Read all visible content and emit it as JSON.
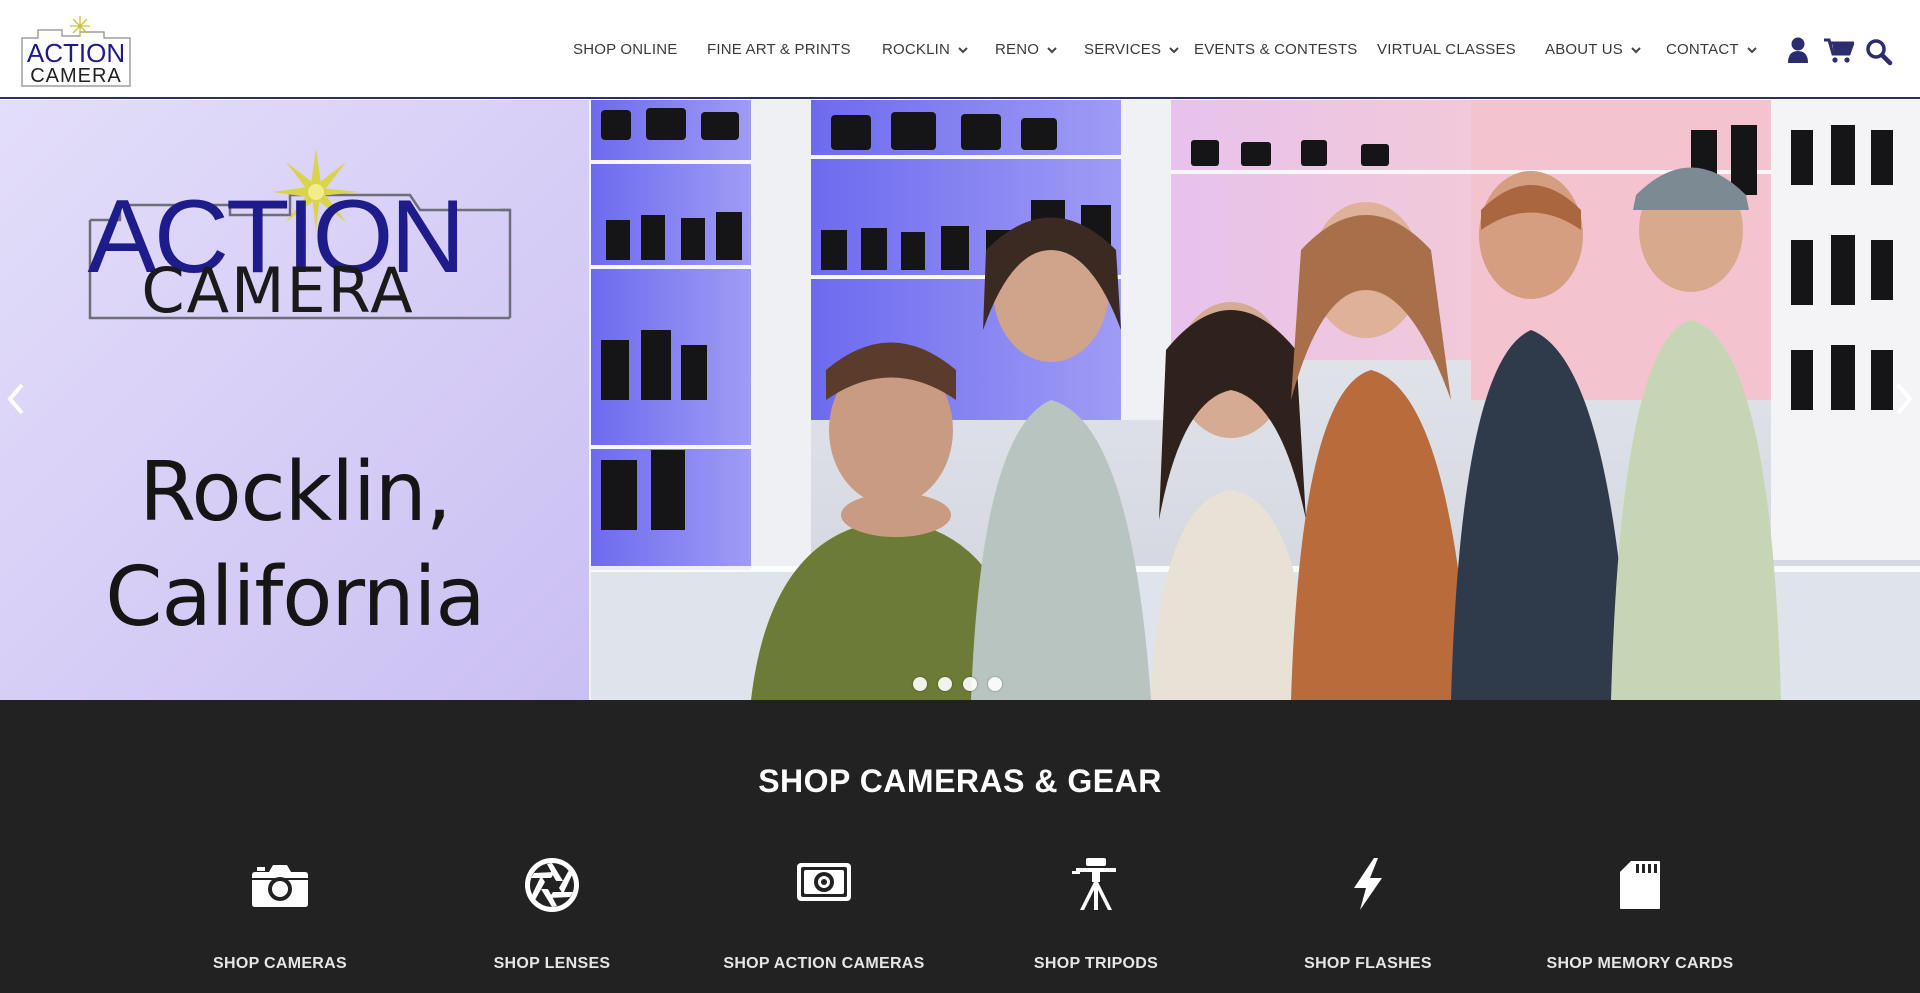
{
  "logo": {
    "line1": "ACTION",
    "line2": "CAMERA"
  },
  "nav": [
    {
      "label": "SHOP ONLINE",
      "dropdown": false
    },
    {
      "label": "FINE ART & PRINTS",
      "dropdown": false
    },
    {
      "label": "ROCKLIN",
      "dropdown": true
    },
    {
      "label": "RENO",
      "dropdown": true
    },
    {
      "label": "SERVICES",
      "dropdown": true
    },
    {
      "label": "EVENTS & CONTESTS",
      "dropdown": false
    },
    {
      "label": "VIRTUAL CLASSES",
      "dropdown": false
    },
    {
      "label": "ABOUT US",
      "dropdown": true
    },
    {
      "label": "CONTACT",
      "dropdown": true
    }
  ],
  "header_icons": [
    "user-icon",
    "cart-icon",
    "search-icon"
  ],
  "hero": {
    "logo_line1": "ACTION",
    "logo_line2": "CAMERA",
    "city_line1": "Rocklin,",
    "city_line2": "California",
    "slide_count": 4,
    "active_slide": 1
  },
  "shop": {
    "title": "SHOP CAMERAS & GEAR",
    "categories": [
      {
        "label": "SHOP CAMERAS",
        "icon": "camera-icon"
      },
      {
        "label": "SHOP LENSES",
        "icon": "aperture-icon"
      },
      {
        "label": "SHOP ACTION CAMERAS",
        "icon": "action-camera-icon"
      },
      {
        "label": "SHOP TRIPODS",
        "icon": "tripod-icon"
      },
      {
        "label": "SHOP FLASHES",
        "icon": "flash-icon"
      },
      {
        "label": "SHOP MEMORY CARDS",
        "icon": "memory-card-icon"
      }
    ]
  },
  "colors": {
    "brand_navy": "#2b2d6e",
    "logo_blue": "#1e1b8a",
    "star_yellow": "#d9d44a",
    "footer_dark": "#222222"
  }
}
